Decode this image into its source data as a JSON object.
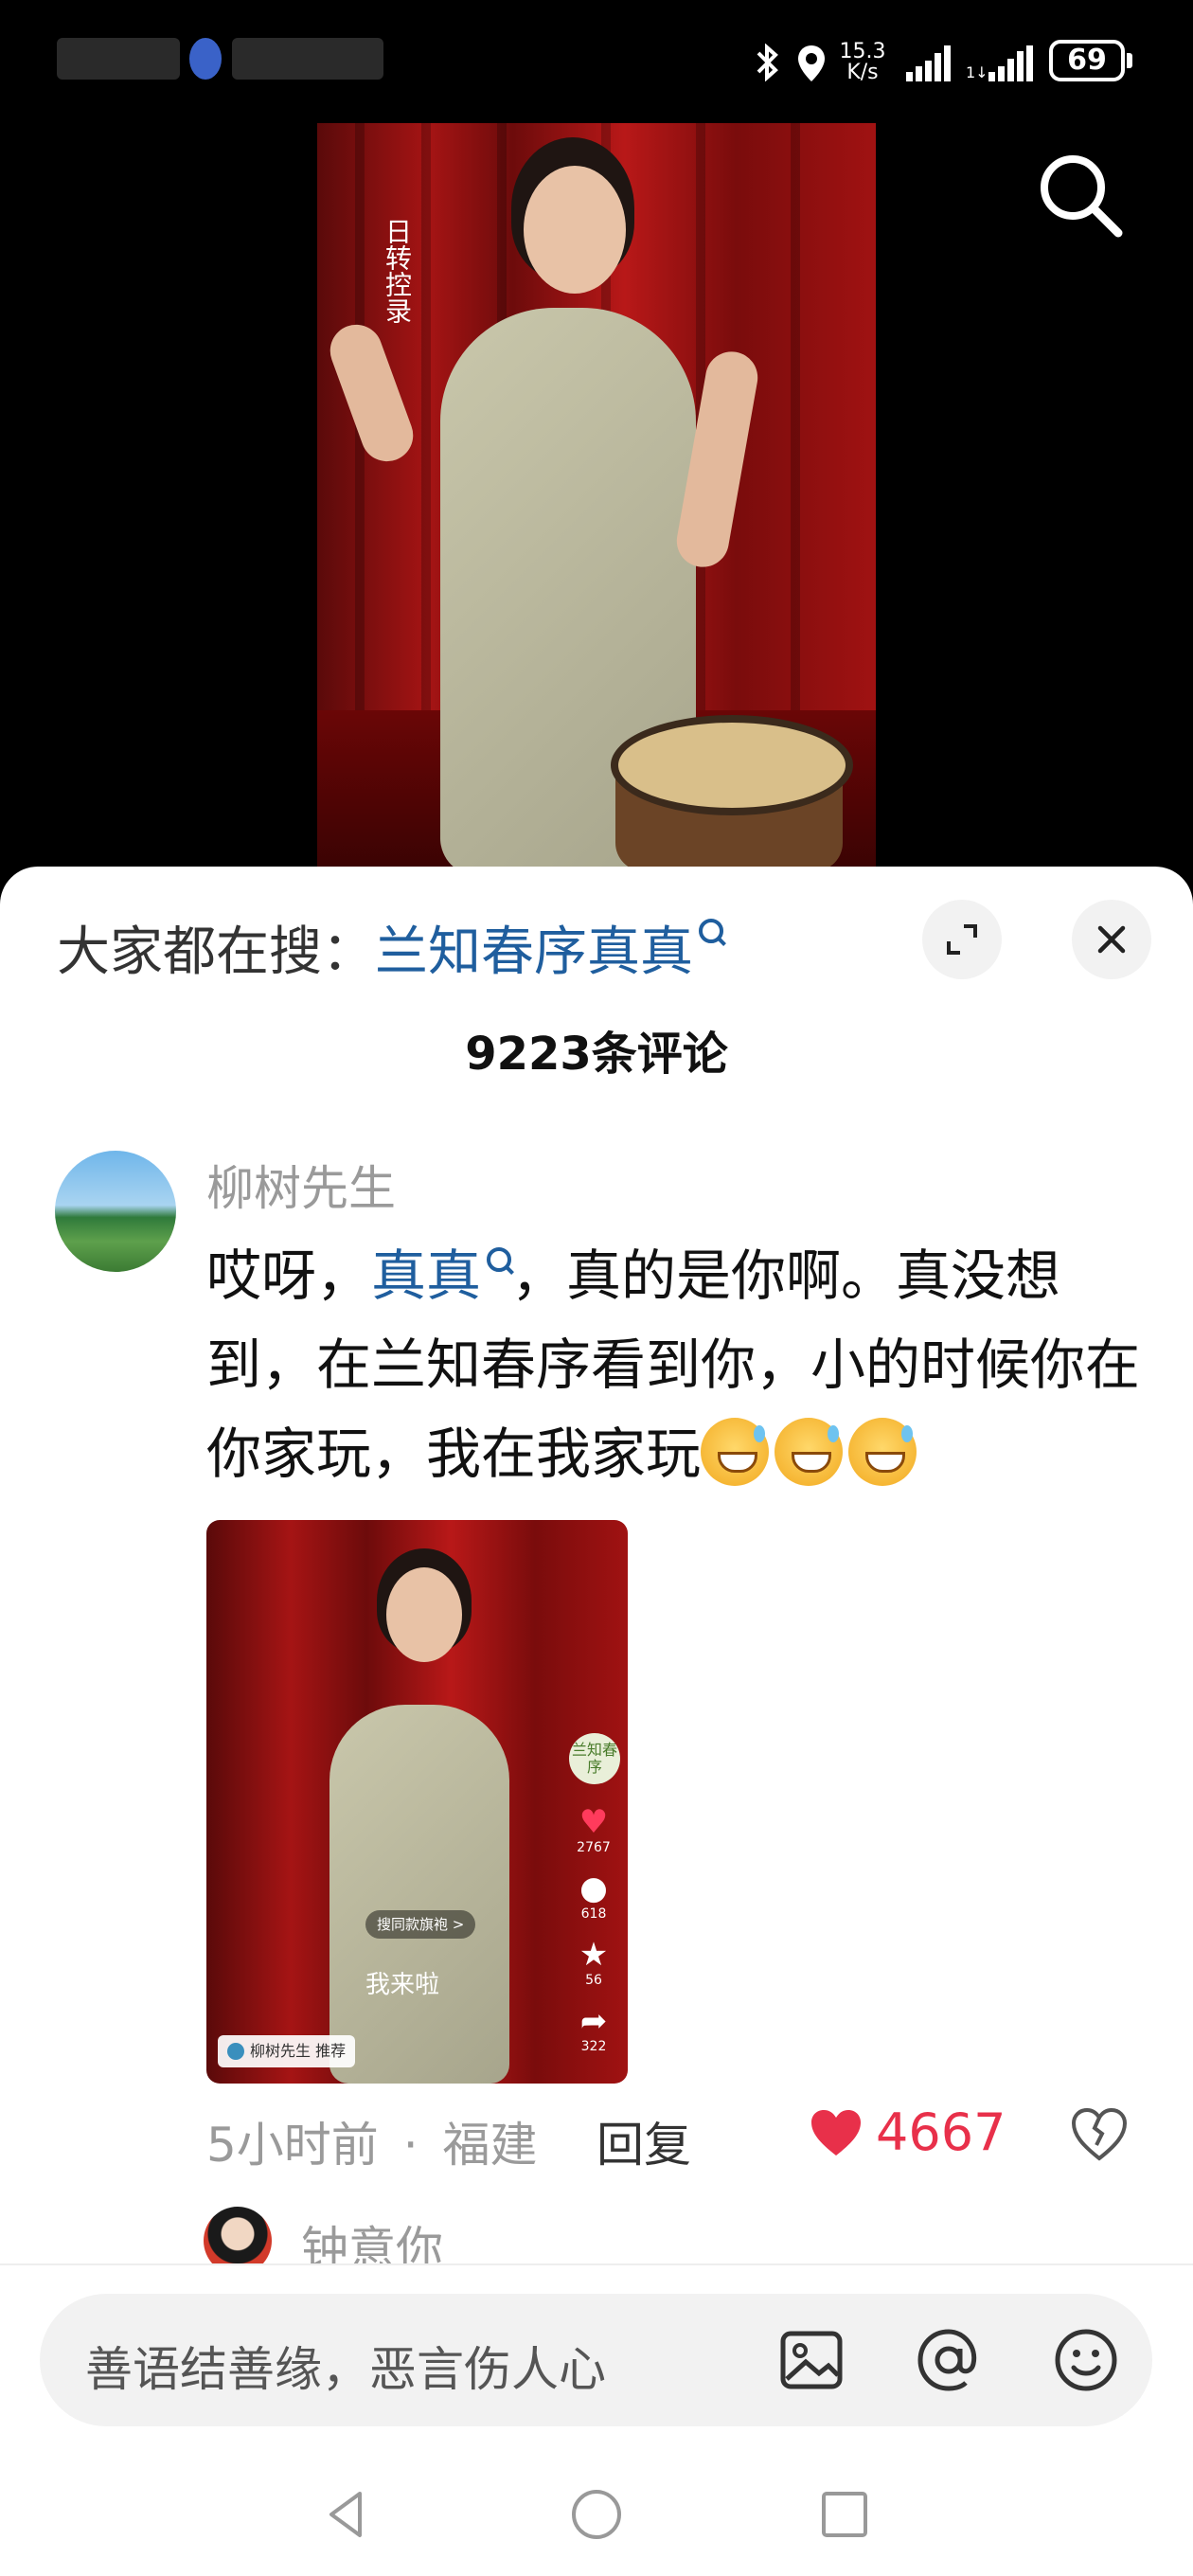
{
  "status_bar": {
    "network_speed_value": "15.3",
    "network_speed_unit": "K/s",
    "battery": "69",
    "icons": [
      "bluetooth-icon",
      "location-icon",
      "signal-icon",
      "signal-icon-2",
      "battery-icon"
    ]
  },
  "video": {
    "caption": "日转控录"
  },
  "search_icon": "search-icon",
  "sheet": {
    "hot_search_label": "大家都在搜：",
    "hot_search_term": "兰知春序真真",
    "comment_count": "9223条评论",
    "expand_icon": "expand-icon",
    "close_icon": "close-icon"
  },
  "comment": {
    "username": "柳树先生",
    "text_before": "哎呀，",
    "text_term": "真真",
    "text_after": "，真的是你啊。真没想到，在兰知春序看到你，小的时候你在你家玩，我在我家玩",
    "image": {
      "brand_badge": "兰知春序",
      "likes": "2767",
      "comments": "618",
      "favorites": "56",
      "shares": "322",
      "pill_text": "搜同款旗袍 >",
      "subtitle": "我来啦",
      "recommend": "柳树先生 推荐"
    },
    "time": "5小时前",
    "location": "福建",
    "separator": "·",
    "reply_label": "回复",
    "likes": "4667"
  },
  "next_comment": {
    "username": "钟意你"
  },
  "input": {
    "placeholder": "善语结善缘，恶言伤人心",
    "icons": [
      "image-icon",
      "at-icon",
      "emoji-icon"
    ]
  },
  "nav": {
    "icons": [
      "back-icon",
      "home-icon",
      "recents-icon"
    ]
  },
  "colors": {
    "link_blue": "#1f5e9e",
    "like_red": "#e8304a",
    "meta_gray": "#9a9a9a"
  }
}
